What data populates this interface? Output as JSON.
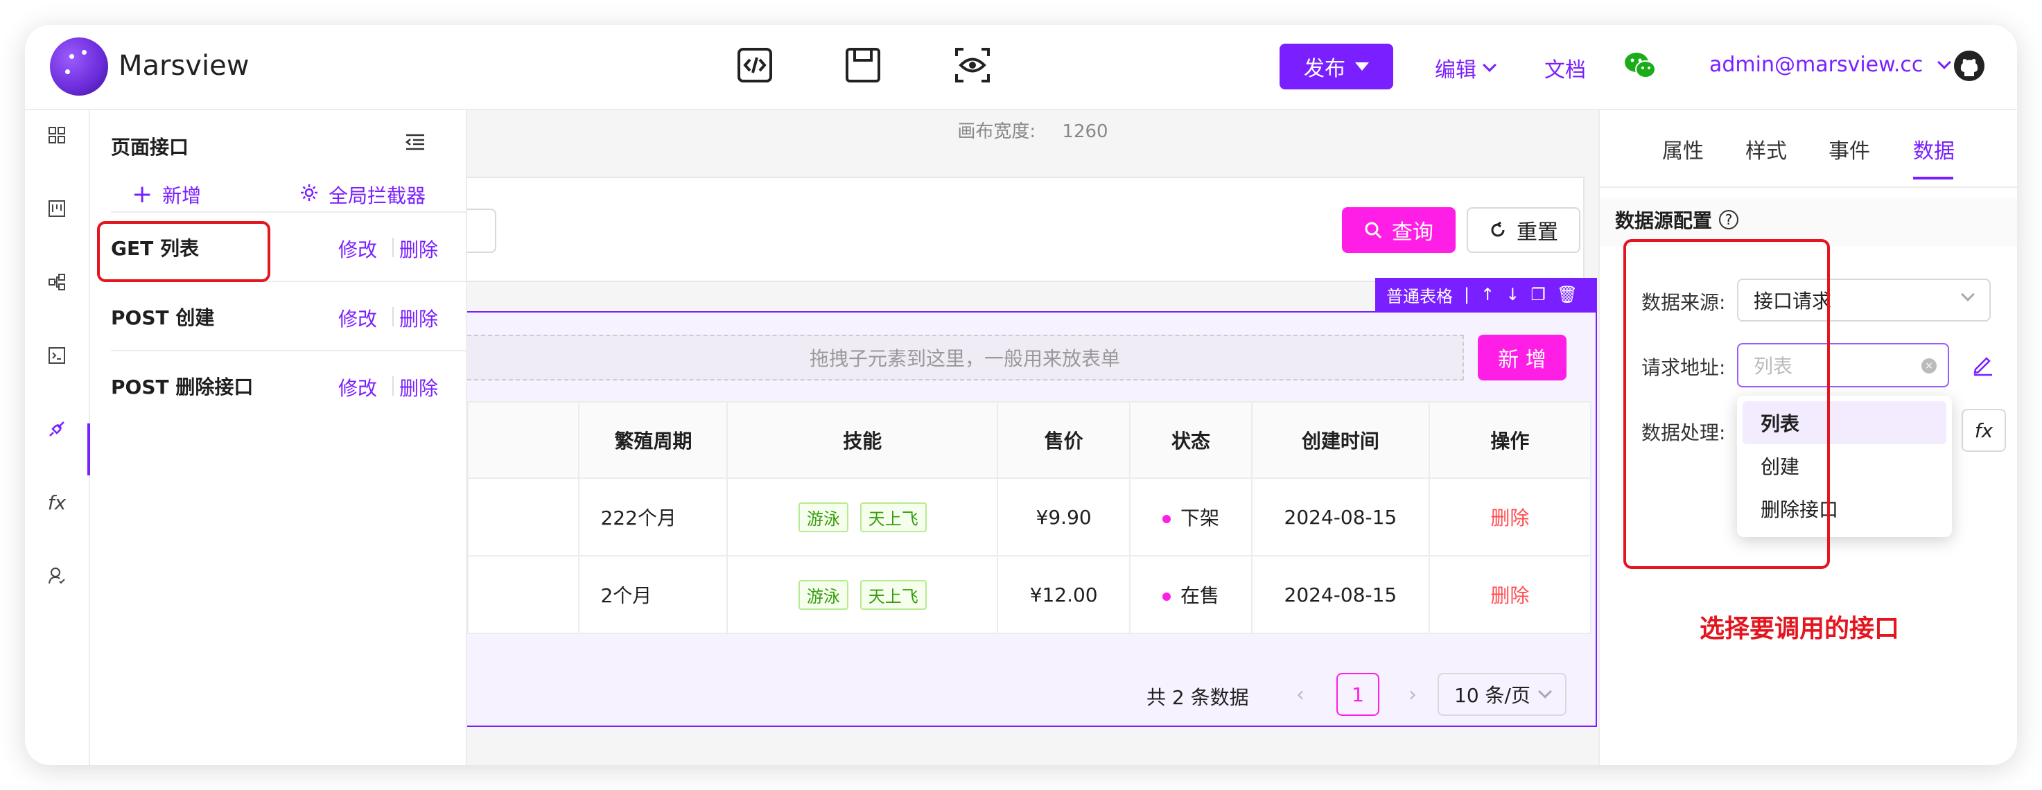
{
  "header": {
    "app_name": "Marsview",
    "toolbar_icons": [
      "code-icon",
      "save-icon",
      "preview-icon"
    ],
    "publish_label": "发布",
    "edit_label": "编辑",
    "docs_label": "文档",
    "user_email": "admin@marsview.cc",
    "accent": "#7a1fff"
  },
  "rail": {
    "icons": [
      "grid-icon",
      "layout-icon",
      "tree-icon",
      "terminal-icon",
      "api-icon",
      "function-icon",
      "user-icon"
    ],
    "fx_label": "fx",
    "active_index": 4
  },
  "api_panel": {
    "title": "页面接口",
    "add_label": "新增",
    "global_label": "全局拦截器",
    "items": [
      {
        "name": "GET 列表",
        "edit": "修改",
        "delete": "删除"
      },
      {
        "name": "POST 创建",
        "edit": "修改",
        "delete": "删除"
      },
      {
        "name": "POST 删除接口",
        "edit": "修改",
        "delete": "删除"
      }
    ]
  },
  "canvas": {
    "width_label": "画布宽度:",
    "width_value": "1260",
    "query_label": "查询",
    "reset_label": "重置",
    "component_tag": "普通表格",
    "drop_hint": "拖拽子元素到这里，一般用来放表单",
    "add_label": "新 增",
    "table": {
      "columns": [
        "繁殖周期",
        "技能",
        "售价",
        "状态",
        "创建时间",
        "操作"
      ],
      "rows": [
        {
          "cycle": "222个月",
          "skills": [
            "游泳",
            "天上飞"
          ],
          "price": "¥9.90",
          "status": "下架",
          "created": "2024-08-15",
          "action": "删除"
        },
        {
          "cycle": "2个月",
          "skills": [
            "游泳",
            "天上飞"
          ],
          "price": "¥12.00",
          "status": "在售",
          "created": "2024-08-15",
          "action": "删除"
        }
      ]
    },
    "pagination": {
      "total": "共 2 条数据",
      "current": "1",
      "page_size": "10 条/页"
    }
  },
  "props_panel": {
    "tabs": [
      "属性",
      "样式",
      "事件",
      "数据"
    ],
    "active_tab": "数据",
    "section_title": "数据源配置",
    "source_label": "数据来源:",
    "source_value": "接口请求",
    "url_label": "请求地址:",
    "url_placeholder": "列表",
    "process_label": "数据处理:",
    "fx_label": "fx",
    "options": [
      "列表",
      "创建",
      "删除接口"
    ],
    "annotation": "选择要调用的接口"
  }
}
